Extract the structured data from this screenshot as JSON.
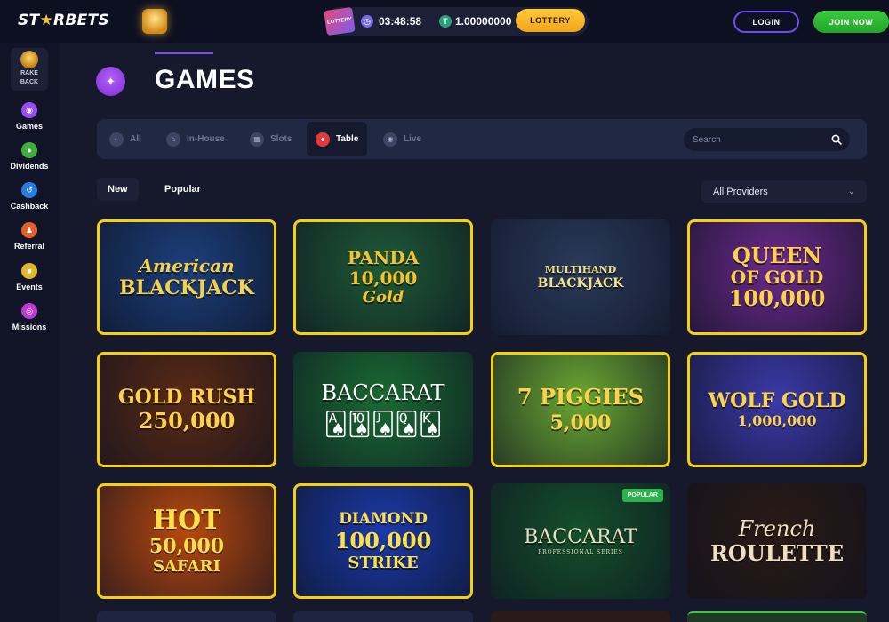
{
  "header": {
    "logo_text_a": "ST",
    "logo_text_b": "★",
    "logo_text_c": "RBETS",
    "ticket_text": "LOTTERY",
    "timer": "03:48:58",
    "coin_symbol": "T",
    "balance": "1.00000000",
    "lottery_button": "LOTTERY",
    "login_button": "LOGIN",
    "join_button": "JOIN NOW"
  },
  "sidebar": {
    "rakeback_label_1": "RAKE",
    "rakeback_label_2": "BACK",
    "items": [
      {
        "label": "Games",
        "color": "#9a4cf2",
        "icon": "gamepad-icon"
      },
      {
        "label": "Dividends",
        "color": "#3fae3f",
        "icon": "coins-icon"
      },
      {
        "label": "Cashback",
        "color": "#2a7ce0",
        "icon": "cashback-icon"
      },
      {
        "label": "Referral",
        "color": "#e0602a",
        "icon": "referral-icon"
      },
      {
        "label": "Events",
        "color": "#e0b92a",
        "icon": "events-icon"
      },
      {
        "label": "Missions",
        "color": "#c03ad6",
        "icon": "missions-icon"
      }
    ]
  },
  "main": {
    "title": "GAMES",
    "tabs": [
      {
        "label": "All",
        "active": false
      },
      {
        "label": "In-House",
        "active": false
      },
      {
        "label": "Slots",
        "active": false
      },
      {
        "label": "Table",
        "active": true
      },
      {
        "label": "Live",
        "active": false
      }
    ],
    "search_placeholder": "Search",
    "sort": [
      "New",
      "Popular"
    ],
    "providers": "All Providers"
  },
  "games": [
    {
      "line1": "American",
      "line2": "BLACKJACK",
      "line3": "",
      "bg": "#1b3f7a",
      "fg": "#f5d04a"
    },
    {
      "line1": "PANDA",
      "line2": "10,000",
      "line3": "Gold",
      "bg": "#1e5a35",
      "fg": "#f6c32d"
    },
    {
      "line1": "MULTIHAND",
      "line2": "BLACKJACK",
      "line3": "",
      "bg": "#2a3a5a",
      "fg": "#f2e28a"
    },
    {
      "line1": "QUEEN",
      "line2": "OF GOLD",
      "line3": "100,000",
      "bg": "#6a2a8a",
      "fg": "#ffd24a"
    },
    {
      "line1": "GOLD RUSH",
      "line2": "250,000",
      "line3": "",
      "bg": "#5a2a14",
      "fg": "#ffd24a"
    },
    {
      "line1": "BACCARAT",
      "line2": "",
      "line3": "",
      "bg": "#1a6a32",
      "fg": "#ffffff"
    },
    {
      "line1": "7 PIGGIES",
      "line2": "5,000",
      "line3": "",
      "bg": "#6aa832",
      "fg": "#ffd24a"
    },
    {
      "line1": "WOLF GOLD",
      "line2": "1,000,000",
      "line3": "",
      "bg": "#3a3aa8",
      "fg": "#ffd24a"
    },
    {
      "line1": "HOT",
      "line2": "50,000",
      "line3": "SAFARI",
      "bg": "#b8480e",
      "fg": "#ffe04a"
    },
    {
      "line1": "DIAMOND",
      "line2": "100,000",
      "line3": "STRIKE",
      "bg": "#1a3aa8",
      "fg": "#ffe04a"
    },
    {
      "line1": "BACCARAT",
      "line2": "PROFESSIONAL SERIES",
      "line3": "",
      "bg": "#14502a",
      "fg": "#e8e0c0",
      "badge": "POPULAR"
    },
    {
      "line1": "French",
      "line2": "ROULETTE",
      "line3": "",
      "bg": "#2a1a14",
      "fg": "#f0e0c0"
    }
  ]
}
